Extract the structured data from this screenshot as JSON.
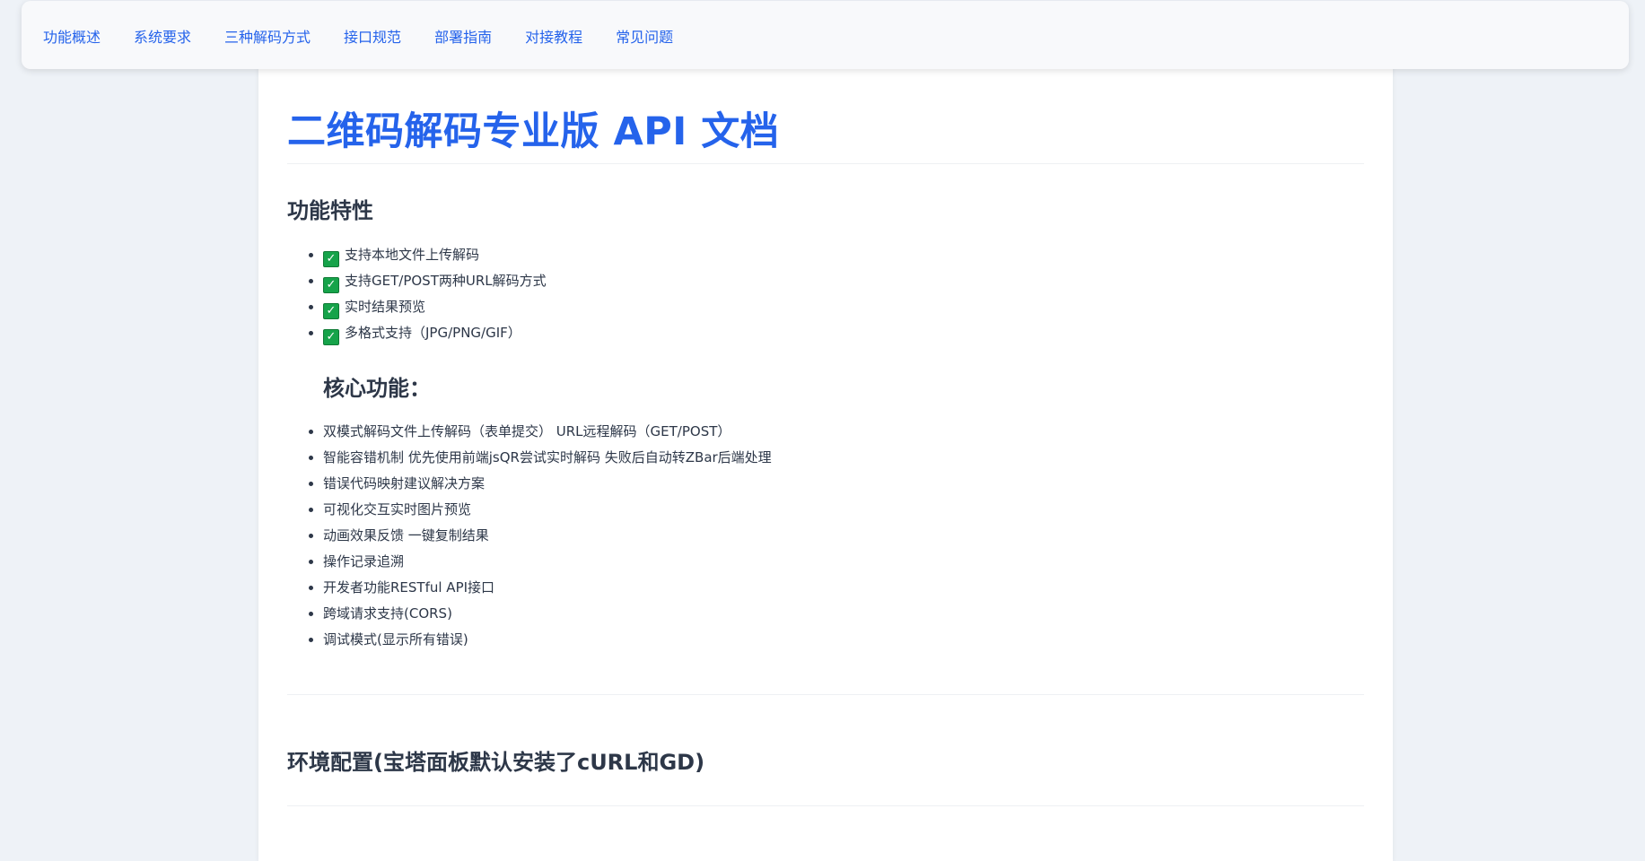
{
  "nav": {
    "items": [
      "功能概述",
      "系统要求",
      "三种解码方式",
      "接口规范",
      "部署指南",
      "对接教程",
      "常见问题"
    ]
  },
  "doc": {
    "title": "二维码解码专业版 API 文档",
    "features_heading": "功能特性",
    "features": [
      "支持本地文件上传解码",
      "支持GET/POST两种URL解码方式",
      "实时结果预览",
      "多格式支持（JPG/PNG/GIF）"
    ],
    "feature_icon": "check-mark-icon",
    "core_heading": "核心功能：",
    "core_items": [
      "双模式解码文件上传解码（表单提交） URL远程解码（GET/POST）",
      "智能容错机制 优先使用前端jsQR尝试实时解码 失败后自动转ZBar后端处理",
      "错误代码映射建议解决方案",
      "可视化交互实时图片预览",
      "动画效果反馈 一键复制结果",
      "操作记录追溯",
      "开发者功能RESTful API接口",
      "跨域请求支持(CORS)",
      "调试模式(显示所有错误)"
    ],
    "env_heading": "环境配置(宝塔面板默认安装了cURL和GD)"
  },
  "colors": {
    "accent": "#2563eb",
    "text": "#2d3748",
    "check": "#16a34a",
    "background": "#eef2f7"
  }
}
